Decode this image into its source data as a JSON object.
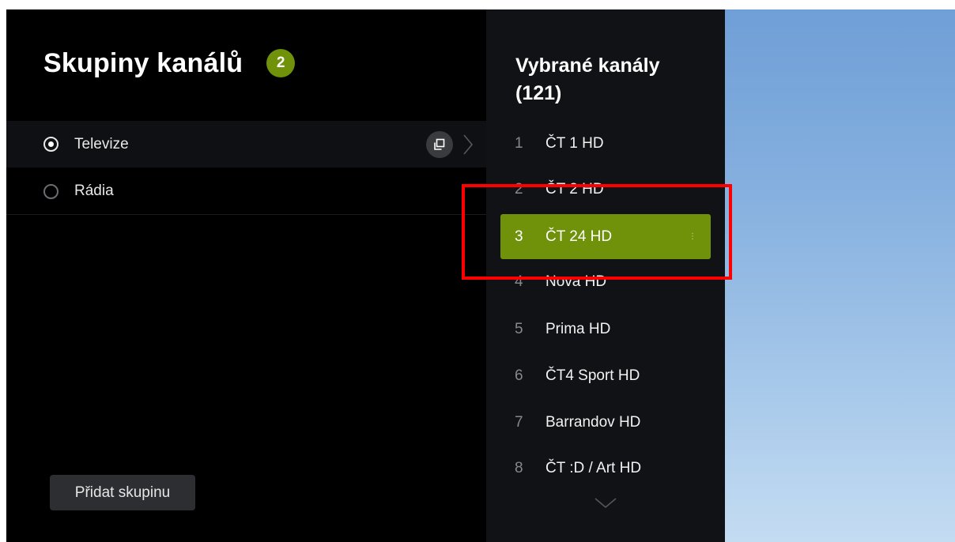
{
  "left_panel": {
    "title": "Skupiny kanálů",
    "badge_count": "2",
    "groups": [
      {
        "label": "Televize",
        "selected": true
      },
      {
        "label": "Rádia",
        "selected": false
      }
    ],
    "add_group_label": "Přidat skupinu"
  },
  "channels_panel": {
    "title": "Vybrané kanály (121)",
    "channels": [
      {
        "num": "1",
        "name": "ČT 1 HD"
      },
      {
        "num": "2",
        "name": "ČT 2 HD"
      },
      {
        "num": "3",
        "name": "ČT 24 HD"
      },
      {
        "num": "4",
        "name": "Nova HD"
      },
      {
        "num": "5",
        "name": "Prima HD"
      },
      {
        "num": "6",
        "name": "ČT4 Sport HD"
      },
      {
        "num": "7",
        "name": "Barrandov HD"
      },
      {
        "num": "8",
        "name": "ČT :D / Art HD"
      }
    ],
    "selected_index": 2
  },
  "icons": {
    "copy": "copy-icon",
    "chevron_right": "chevron-right-icon",
    "chevron_down": "chevron-down-icon",
    "more": "more-dots-icon"
  },
  "colors": {
    "accent": "#6f920a",
    "annotation": "#ff0000"
  }
}
